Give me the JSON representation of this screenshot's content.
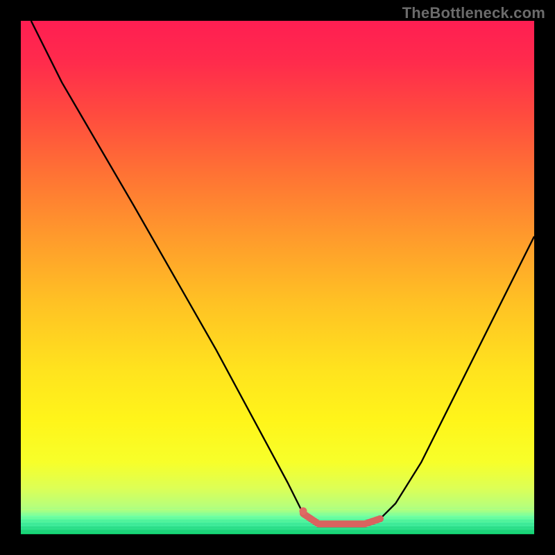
{
  "watermark": "TheBottleneck.com",
  "gradient": {
    "stops": [
      {
        "offset": 0.0,
        "color": "#ff1e52"
      },
      {
        "offset": 0.08,
        "color": "#ff2b4c"
      },
      {
        "offset": 0.18,
        "color": "#ff4a3f"
      },
      {
        "offset": 0.3,
        "color": "#ff7334"
      },
      {
        "offset": 0.42,
        "color": "#ff9a2c"
      },
      {
        "offset": 0.55,
        "color": "#ffc224"
      },
      {
        "offset": 0.68,
        "color": "#ffe31e"
      },
      {
        "offset": 0.78,
        "color": "#fff51a"
      },
      {
        "offset": 0.86,
        "color": "#f7ff2a"
      },
      {
        "offset": 0.91,
        "color": "#ddff55"
      },
      {
        "offset": 0.945,
        "color": "#b8ff7a"
      },
      {
        "offset": 0.965,
        "color": "#8eff94"
      },
      {
        "offset": 0.982,
        "color": "#5cffb0"
      },
      {
        "offset": 1.0,
        "color": "#12e97a"
      }
    ]
  },
  "thin_green_lines": {
    "count": 18,
    "colors": [
      "#b8ff7a",
      "#a6ff84",
      "#93ff8f",
      "#7fff9a",
      "#6cffa4",
      "#5affad",
      "#49f9a6",
      "#3cf2a0",
      "#30ea98",
      "#28e290",
      "#22db89",
      "#1ed483",
      "#1bce7d",
      "#18c878",
      "#16c273",
      "#14bd6e",
      "#12b869",
      "#11b365"
    ]
  },
  "chart_data": {
    "type": "line",
    "title": "",
    "xlabel": "",
    "ylabel": "",
    "xlim": [
      0,
      100
    ],
    "ylim": [
      0,
      100
    ],
    "series": [
      {
        "name": "bottleneck-curve",
        "x": [
          2,
          8,
          15,
          22,
          30,
          38,
          45,
          52,
          55,
          58,
          62,
          67,
          70,
          73,
          78,
          85,
          92,
          100
        ],
        "y": [
          100,
          88,
          76,
          64,
          50,
          36,
          23,
          10,
          4,
          2,
          2,
          2,
          3,
          6,
          14,
          28,
          42,
          58
        ]
      }
    ],
    "highlight": {
      "name": "optimal-range",
      "x": [
        55,
        58,
        62,
        67,
        70
      ],
      "y": [
        4,
        2,
        2,
        2,
        3
      ]
    },
    "marker": {
      "x": 55,
      "y": 4.5
    }
  }
}
